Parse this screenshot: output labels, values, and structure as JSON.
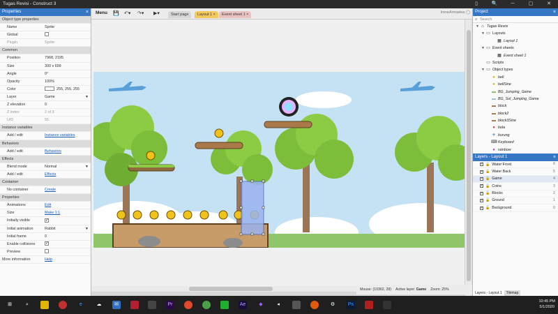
{
  "title": "Tugas Revisi - Construct 3",
  "window_controls": [
    "▯",
    "🔍",
    "─",
    "▢",
    "✕"
  ],
  "toolbar": {
    "menu_label": "Menu",
    "tabs": [
      {
        "label": "Start page"
      },
      {
        "label": "Layout 1",
        "closable": "×"
      },
      {
        "label": "Event sheet 1",
        "closable": "×"
      }
    ],
    "user": "IreneArmadea"
  },
  "properties": {
    "panel_title": "Properties",
    "rows": [
      {
        "type": "section",
        "label": "Object type properties"
      },
      {
        "label": "Name",
        "value": "Sprite"
      },
      {
        "label": "Global",
        "checkbox": false
      },
      {
        "label": "Plugin",
        "value": "Sprite",
        "disabled": true
      },
      {
        "type": "section",
        "label": "Common"
      },
      {
        "label": "Position",
        "value": "7968, 2195",
        "expander": true
      },
      {
        "label": "Size",
        "value": "300 x 699",
        "expander": true
      },
      {
        "label": "Angle",
        "value": "0°"
      },
      {
        "label": "Opacity",
        "value": "100%"
      },
      {
        "label": "Color",
        "value": "255, 255, 255",
        "swatch": true
      },
      {
        "label": "Layer",
        "value": "Game",
        "dropdown": true
      },
      {
        "label": "Z elevation",
        "value": "0"
      },
      {
        "label": "Z index",
        "value": "2 of 3",
        "disabled": true
      },
      {
        "label": "UID",
        "value": "55",
        "disabled": true
      },
      {
        "type": "section",
        "label": "Instance variables"
      },
      {
        "label": "Add / edit",
        "link": "Instance variables"
      },
      {
        "type": "section",
        "label": "Behaviors"
      },
      {
        "label": "Add / edit",
        "link": "Behaviors"
      },
      {
        "type": "section",
        "label": "Effects"
      },
      {
        "label": "Blend mode",
        "value": "Normal",
        "dropdown": true
      },
      {
        "label": "Add / edit",
        "link": "Effects"
      },
      {
        "type": "section",
        "label": "Container"
      },
      {
        "label": "No container",
        "link": "Create"
      },
      {
        "type": "section",
        "label": "Properties"
      },
      {
        "label": "Animations",
        "link": "Edit"
      },
      {
        "label": "Size",
        "link": "Make 1:1"
      },
      {
        "label": "Initially visible",
        "checkbox": true
      },
      {
        "label": "Initial animation",
        "value": "Rabbit",
        "dropdown": true
      },
      {
        "label": "Initial frame",
        "value": "0"
      },
      {
        "label": "Enable collisions",
        "checkbox": true
      },
      {
        "label": "Preview",
        "checkbox": false
      },
      {
        "label": "More information",
        "link": "Help",
        "nopad": true
      }
    ]
  },
  "status": {
    "mouse": "Mouse: (10362, 28)",
    "active_layer_label": "Active layer:",
    "active_layer": "Game",
    "zoom": "Zoom: 25%"
  },
  "project": {
    "panel_title": "Project",
    "search_placeholder": "Search",
    "items": [
      {
        "label": "Tugas Revisi",
        "icon": "⌂",
        "arrow": "▼",
        "indent": 0,
        "italic": true
      },
      {
        "label": "Layouts",
        "icon": "▭",
        "arrow": "▼",
        "indent": 1
      },
      {
        "label": "Layout 1",
        "icon": "▦",
        "indent": 3,
        "italic": true
      },
      {
        "label": "Event sheets",
        "icon": "▭",
        "arrow": "▼",
        "indent": 1
      },
      {
        "label": "Event sheet 1",
        "icon": "▦",
        "indent": 3,
        "italic": true
      },
      {
        "label": "Scripts",
        "icon": "▭",
        "indent": 1
      },
      {
        "label": "Object types",
        "icon": "▭",
        "arrow": "▼",
        "indent": 1
      },
      {
        "label": "bell",
        "icon": "●",
        "color": "#e0b400",
        "indent": 2,
        "italic": true
      },
      {
        "label": "bellSine",
        "icon": "●",
        "color": "#e0b400",
        "indent": 2,
        "italic": true
      },
      {
        "label": "BG_Jumping_Game",
        "icon": "▬",
        "color": "#7fbf5f",
        "indent": 2,
        "italic": true
      },
      {
        "label": "BG_Sol_Jumping_Game",
        "icon": "▬",
        "color": "#8fbfdf",
        "indent": 2,
        "italic": true
      },
      {
        "label": "block",
        "icon": "▬",
        "color": "#a07040",
        "indent": 2,
        "italic": true
      },
      {
        "label": "block2",
        "icon": "▬",
        "color": "#a07040",
        "indent": 2,
        "italic": true
      },
      {
        "label": "block3Sine",
        "icon": "▬",
        "color": "#a07040",
        "indent": 2,
        "italic": true
      },
      {
        "label": "bola",
        "icon": "●",
        "color": "#d04040",
        "indent": 2,
        "italic": true
      },
      {
        "label": "burung",
        "icon": "✈",
        "color": "#3070c0",
        "indent": 2,
        "italic": true
      },
      {
        "label": "Keyboard",
        "icon": "⌨",
        "color": "#333333",
        "indent": 2,
        "italic": true
      },
      {
        "label": "rainbow",
        "icon": "●",
        "color": "#c040c0",
        "indent": 2,
        "italic": true
      }
    ]
  },
  "layers": {
    "panel_title": "Layers - Layout 1",
    "items": [
      {
        "label": "Water Front",
        "num": "6"
      },
      {
        "label": "Water Back",
        "num": "5"
      },
      {
        "label": "Game",
        "num": "4",
        "selected": true
      },
      {
        "label": "Coins",
        "num": "3"
      },
      {
        "label": "Blocks",
        "num": "2"
      },
      {
        "label": "Ground",
        "num": "1"
      },
      {
        "label": "Background",
        "num": "0"
      }
    ],
    "bottom_tabs": [
      "Layers - Layout 1",
      "Tilemap"
    ]
  },
  "taskbar": {
    "time": "10:45 PM",
    "date": "5/1/2020"
  },
  "colors": {
    "accent": "#3576c5",
    "tab_active": "#f4c95d",
    "tab_event": "#e9c2c2",
    "sky": "#c4e2f3"
  }
}
